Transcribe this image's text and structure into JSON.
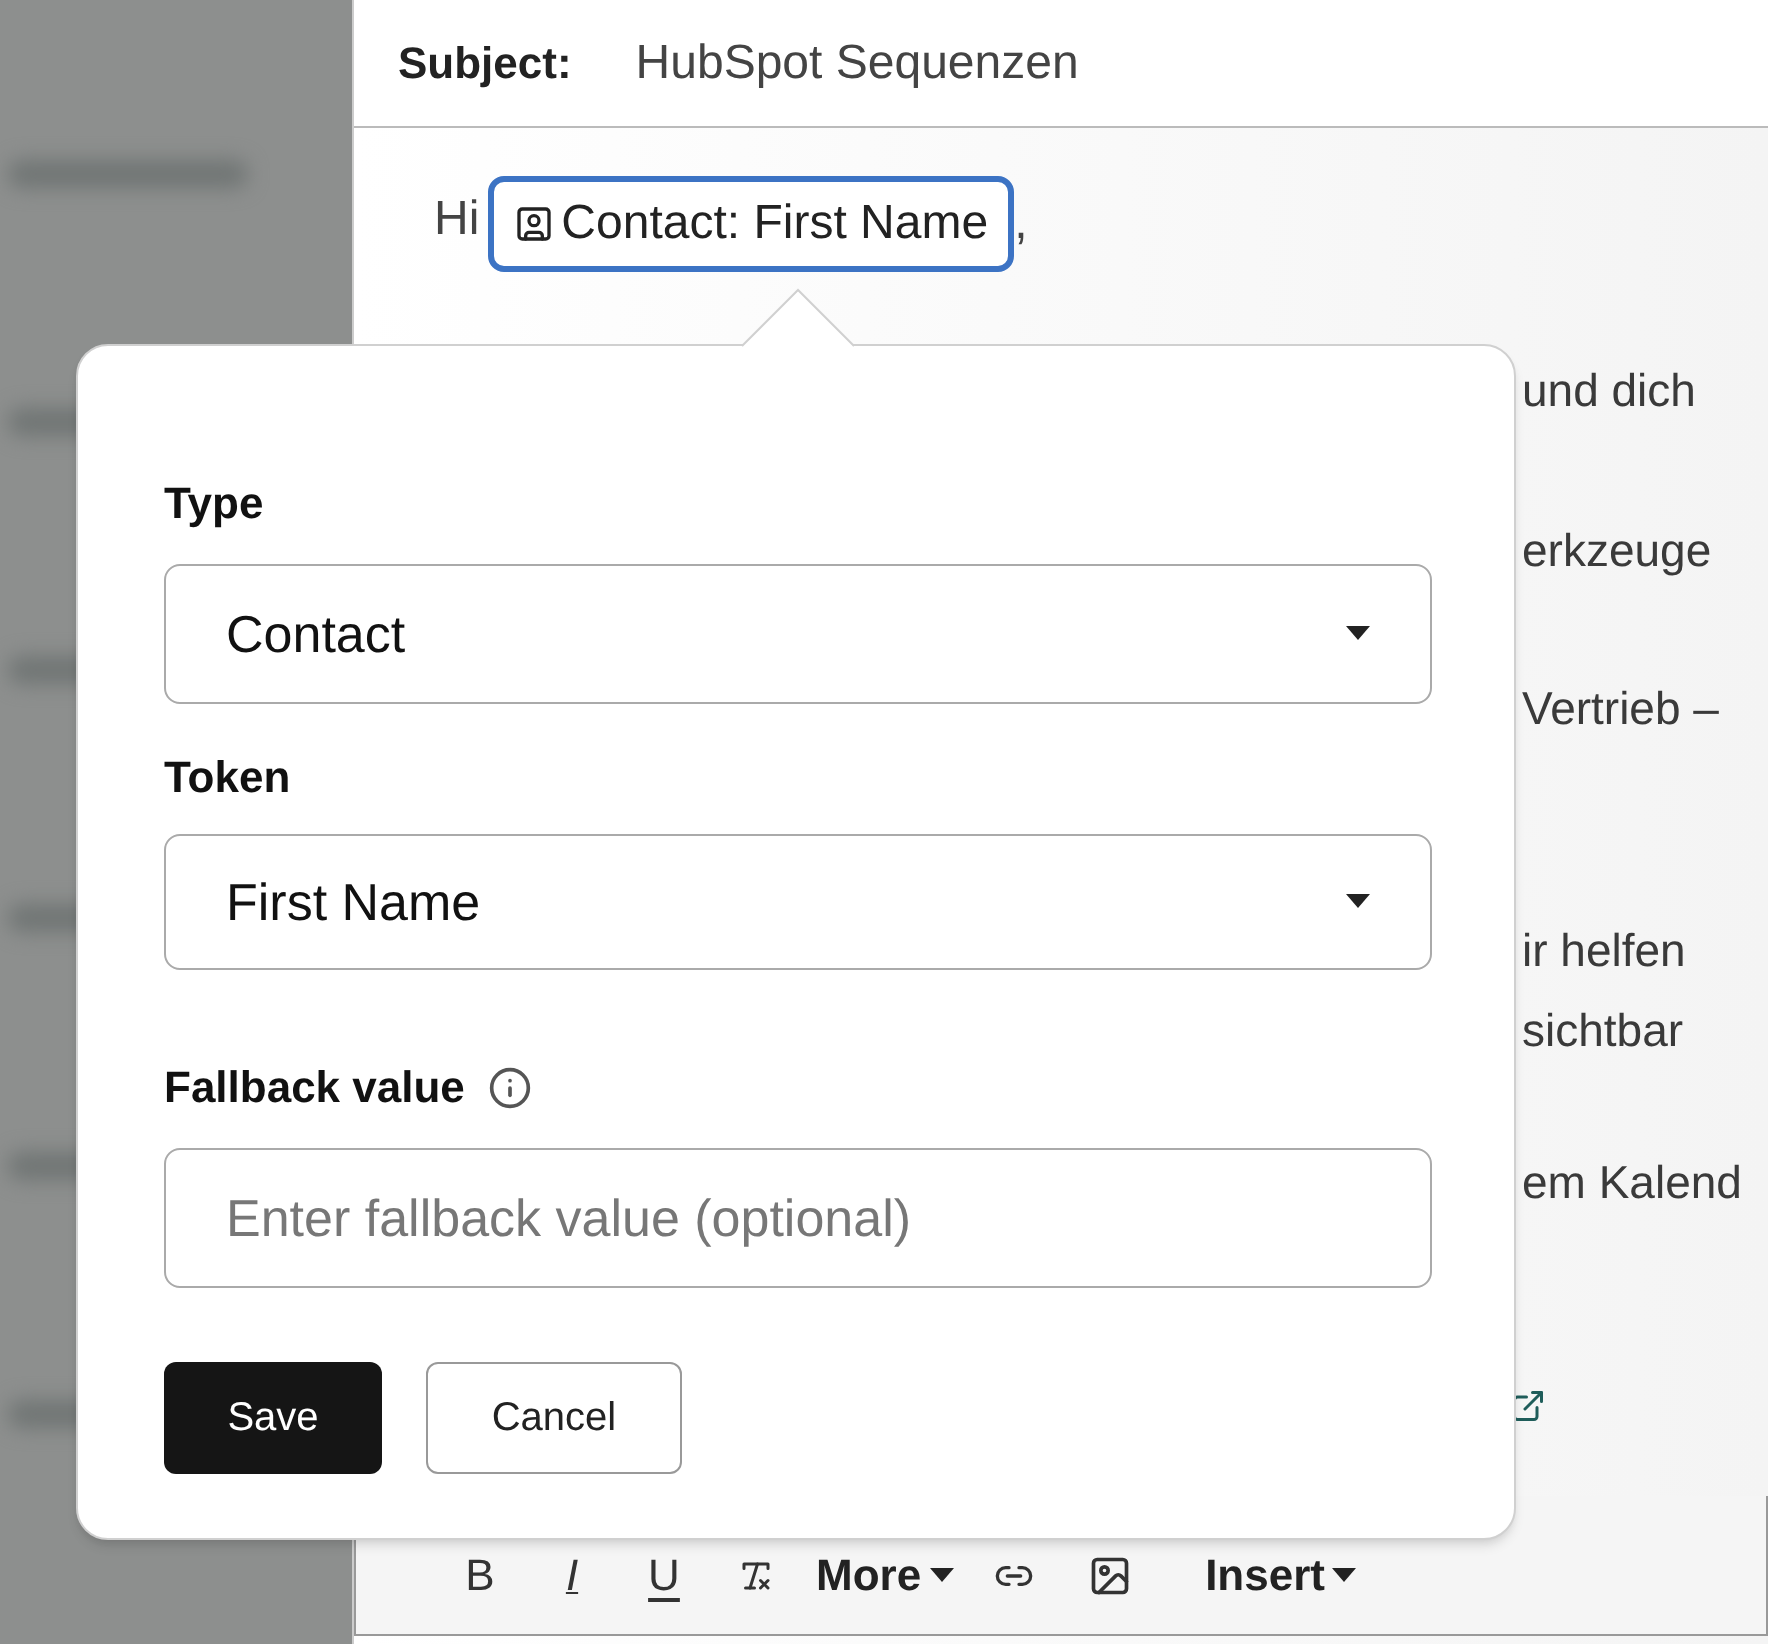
{
  "subject": {
    "label": "Subject:",
    "value": "HubSpot Sequenzen"
  },
  "greeting": {
    "text": "Hi",
    "token": "Contact: First Name",
    "after": ","
  },
  "body_fragments": [
    {
      "text": "und dich"
    },
    {
      "text": "erkzeuge"
    },
    {
      "text": "Vertrieb –"
    },
    {
      "text": "ir helfen"
    },
    {
      "text": "sichtbar"
    },
    {
      "text": "em Kalend"
    }
  ],
  "popover": {
    "type": {
      "label": "Type",
      "value": "Contact"
    },
    "token": {
      "label": "Token",
      "value": "First Name"
    },
    "fallback": {
      "label": "Fallback value",
      "placeholder": "Enter fallback value (optional)"
    },
    "buttons": [
      {
        "label": "Save",
        "kind": "primary"
      },
      {
        "label": "Cancel",
        "kind": "secondary"
      }
    ]
  },
  "toolbar": [
    {
      "kind": "bold",
      "label": "B"
    },
    {
      "kind": "italic",
      "label": "I"
    },
    {
      "kind": "underline",
      "label": "U"
    },
    {
      "kind": "clear"
    },
    {
      "kind": "menu",
      "label": "More"
    },
    {
      "kind": "link"
    },
    {
      "kind": "image"
    },
    {
      "kind": "menu",
      "label": "Insert"
    }
  ]
}
